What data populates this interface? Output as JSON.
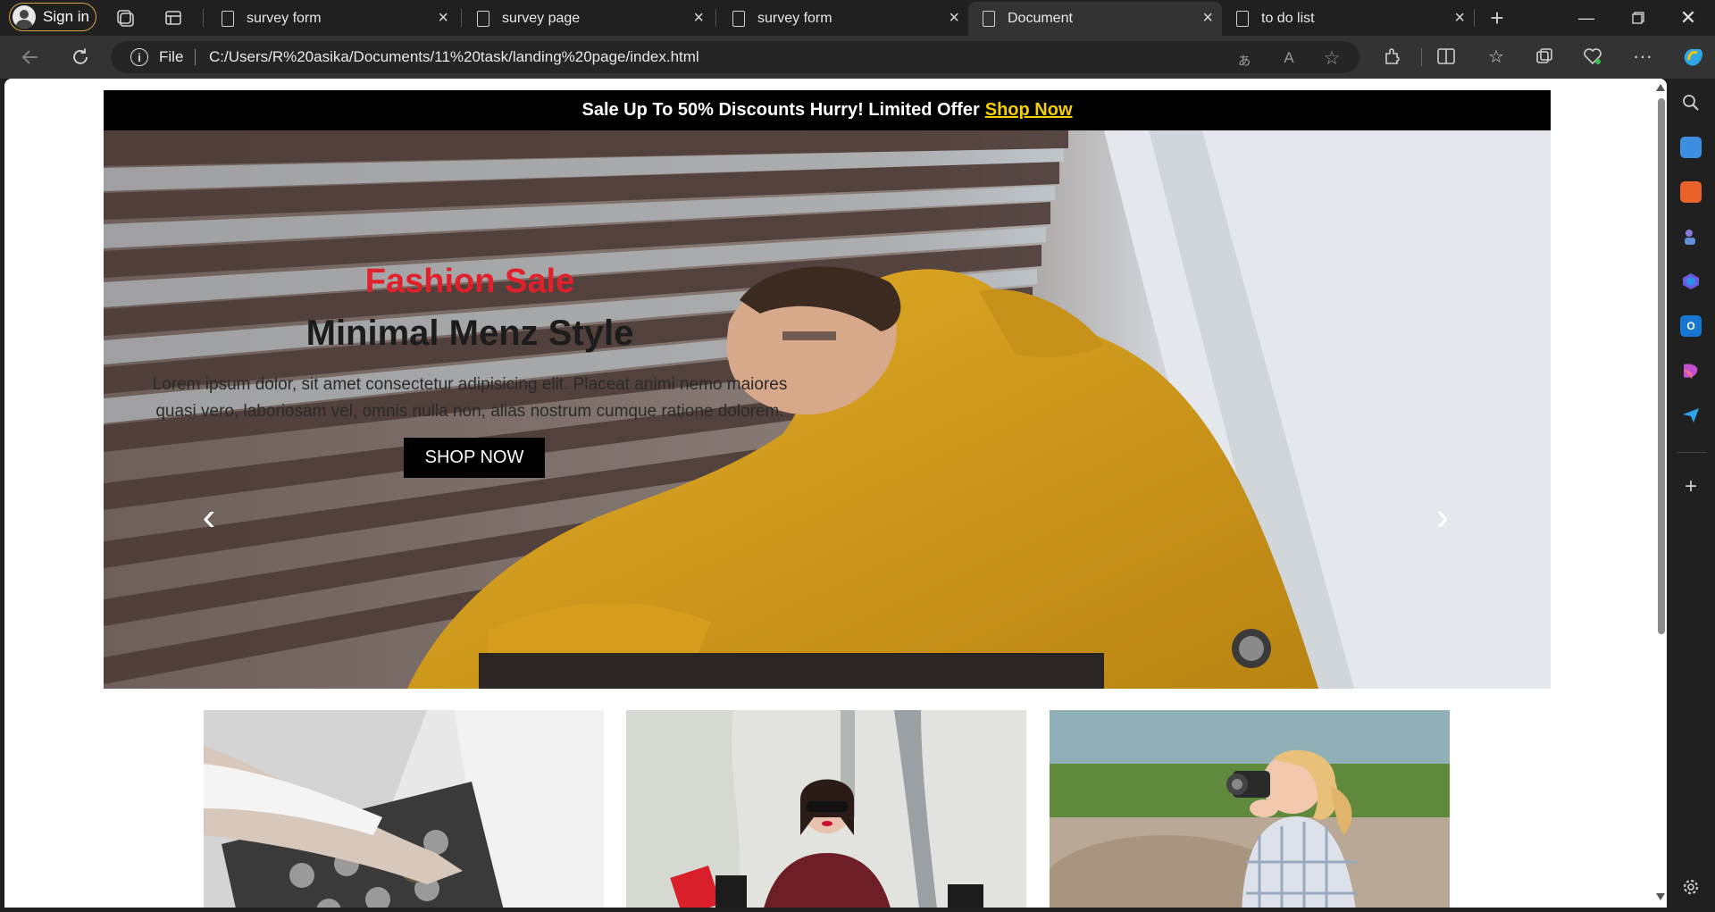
{
  "browser": {
    "signin_label": "Sign in",
    "tabs": [
      {
        "title": "survey form",
        "active": false
      },
      {
        "title": "survey page",
        "active": false
      },
      {
        "title": "survey form",
        "active": false
      },
      {
        "title": "Document",
        "active": true
      },
      {
        "title": "to do list",
        "active": false
      }
    ],
    "address": {
      "scheme": "File",
      "url": "C:/Users/R%20asika/Documents/11%20task/landing%20page/index.html"
    },
    "icons": {
      "back": "back-arrow-icon",
      "reload": "refresh-icon",
      "info": "info-icon",
      "new_tab": "plus-icon"
    }
  },
  "page": {
    "promo": {
      "text": "Sale Up To 50% Discounts Hurry! Limited Offer",
      "link": "Shop Now"
    },
    "hero": {
      "kicker": "Fashion Sale",
      "headline": "Minimal Menz Style",
      "body": "Lorem ipsum dolor, sit amet consectetur adipisicing elit. Placeat animi nemo maiores quasi vero, laboriosam vel, omnis nulla non, alias nostrum cumque ratione dolorem.",
      "cta": "SHOP NOW",
      "prev": "‹",
      "next": "›"
    },
    "colors": {
      "promo_bg": "#000000",
      "promo_link": "#f4d000",
      "kicker": "#e0202a",
      "cta_bg": "#000000"
    }
  }
}
